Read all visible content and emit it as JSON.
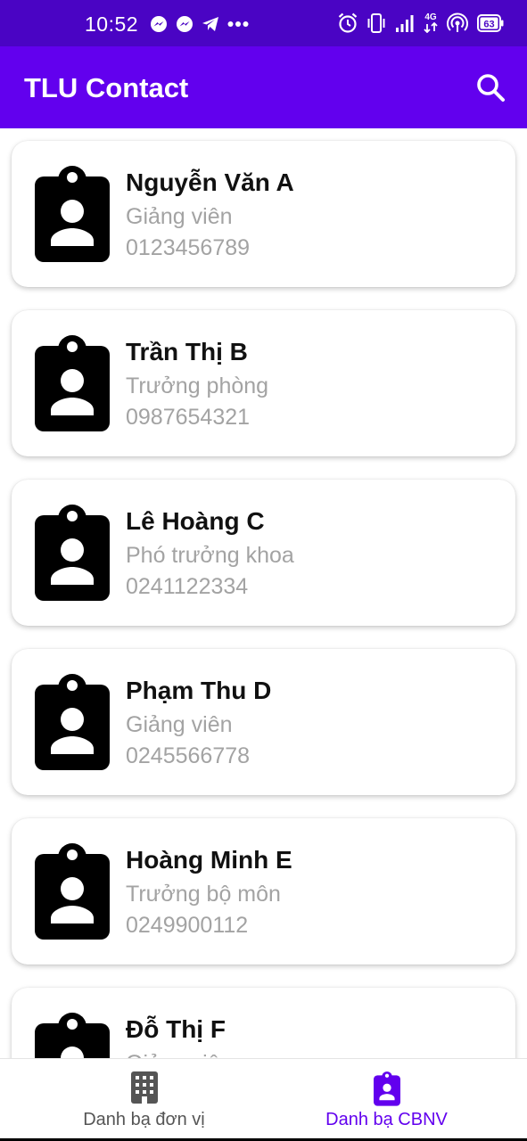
{
  "status_bar": {
    "time": "10:52",
    "network_label": "4G",
    "battery_level": "63",
    "left_icons": [
      "messenger-icon",
      "messenger-icon",
      "telegram-icon",
      "more-dots-icon"
    ],
    "right_icons": [
      "alarm-icon",
      "vibrate-icon",
      "signal-icon",
      "network-4g-icon",
      "hotspot-icon",
      "battery-icon"
    ]
  },
  "app_bar": {
    "title": "TLU Contact",
    "search_icon": "search-icon"
  },
  "contacts": [
    {
      "name": "Nguyễn Văn A",
      "role": "Giảng viên",
      "phone": "0123456789"
    },
    {
      "name": "Trần Thị B",
      "role": "Trưởng phòng",
      "phone": "0987654321"
    },
    {
      "name": "Lê Hoàng C",
      "role": "Phó trưởng khoa",
      "phone": "0241122334"
    },
    {
      "name": "Phạm Thu D",
      "role": "Giảng viên",
      "phone": "0245566778"
    },
    {
      "name": "Hoàng Minh E",
      "role": "Trưởng bộ môn",
      "phone": "0249900112"
    },
    {
      "name": "Đỗ Thị F",
      "role": "Giảng viên",
      "phone": ""
    }
  ],
  "bottom_nav": {
    "items": [
      {
        "label": "Danh bạ đơn vị",
        "icon": "building-icon",
        "selected": false
      },
      {
        "label": "Danh bạ CBNV",
        "icon": "badge-icon",
        "selected": true
      }
    ],
    "active_color": "#6200ee"
  },
  "colors": {
    "status_bar": "#4a04c4",
    "app_bar": "#6200ee",
    "secondary_text": "#a3a3a3"
  }
}
